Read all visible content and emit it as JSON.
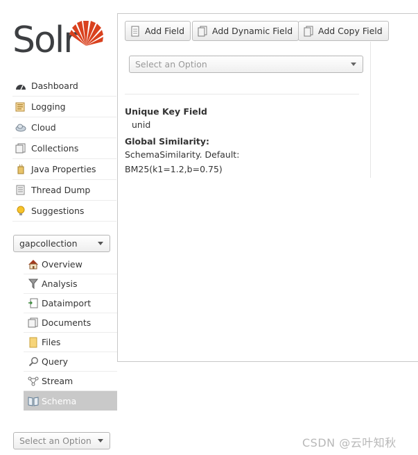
{
  "logo": {
    "text": "Solr",
    "accent_color": "#d9411e"
  },
  "nav": {
    "items": [
      {
        "label": "Dashboard",
        "icon": "dashboard-icon"
      },
      {
        "label": "Logging",
        "icon": "logging-icon"
      },
      {
        "label": "Cloud",
        "icon": "cloud-icon"
      },
      {
        "label": "Collections",
        "icon": "collections-icon"
      },
      {
        "label": "Java Properties",
        "icon": "java-icon"
      },
      {
        "label": "Thread Dump",
        "icon": "thread-dump-icon"
      },
      {
        "label": "Suggestions",
        "icon": "bulb-icon"
      }
    ]
  },
  "core_selector": {
    "value": "gapcollection"
  },
  "core_menu": {
    "items": [
      {
        "label": "Overview",
        "icon": "home-icon"
      },
      {
        "label": "Analysis",
        "icon": "funnel-icon"
      },
      {
        "label": "Dataimport",
        "icon": "dataimport-icon"
      },
      {
        "label": "Documents",
        "icon": "documents-icon"
      },
      {
        "label": "Files",
        "icon": "folder-icon"
      },
      {
        "label": "Query",
        "icon": "magnifier-icon"
      },
      {
        "label": "Stream",
        "icon": "stream-icon"
      },
      {
        "label": "Schema",
        "icon": "book-icon",
        "active": true
      }
    ]
  },
  "bottom_selector": {
    "placeholder": "Select an Option"
  },
  "toolbar": {
    "add_field": "Add Field",
    "add_dynamic_field": "Add Dynamic Field",
    "add_copy_field": "Add Copy Field"
  },
  "field_selector": {
    "placeholder": "Select an Option"
  },
  "schema_info": {
    "unique_key_title": "Unique Key Field",
    "unique_key_value": "unid",
    "similarity_title": "Global Similarity:",
    "similarity_line1": "SchemaSimilarity. Default:",
    "similarity_line2": "BM25(k1=1.2,b=0.75)"
  },
  "watermark": "CSDN @云叶知秋"
}
